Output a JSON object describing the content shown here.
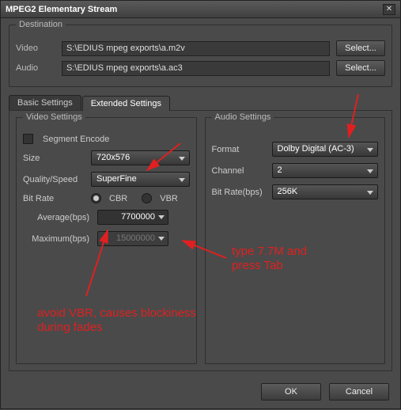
{
  "window": {
    "title": "MPEG2 Elementary Stream"
  },
  "destination": {
    "title": "Destination",
    "video_label": "Video",
    "video_path": "S:\\EDIUS mpeg exports\\a.m2v",
    "audio_label": "Audio",
    "audio_path": "S:\\EDIUS mpeg exports\\a.ac3",
    "select_label": "Select..."
  },
  "tabs": {
    "basic": "Basic Settings",
    "extended": "Extended Settings"
  },
  "video_settings": {
    "title": "Video Settings",
    "segment_encode": "Segment Encode",
    "size_label": "Size",
    "size_value": "720x576",
    "quality_label": "Quality/Speed",
    "quality_value": "SuperFine",
    "bitrate_label": "Bit Rate",
    "cbr": "CBR",
    "vbr": "VBR",
    "average_label": "Average(bps)",
    "average_value": "7700000",
    "maximum_label": "Maximum(bps)",
    "maximum_value": "15000000"
  },
  "audio_settings": {
    "title": "Audio Settings",
    "format_label": "Format",
    "format_value": "Dolby Digital (AC-3)",
    "channel_label": "Channel",
    "channel_value": "2",
    "bitrate_label": "Bit Rate(bps)",
    "bitrate_value": "256K"
  },
  "buttons": {
    "ok": "OK",
    "cancel": "Cancel"
  },
  "annotations": {
    "type_tab": "type 7.7M and\npress Tab",
    "avoid_vbr": "avoid VBR, causes blockiness\nduring fades"
  }
}
